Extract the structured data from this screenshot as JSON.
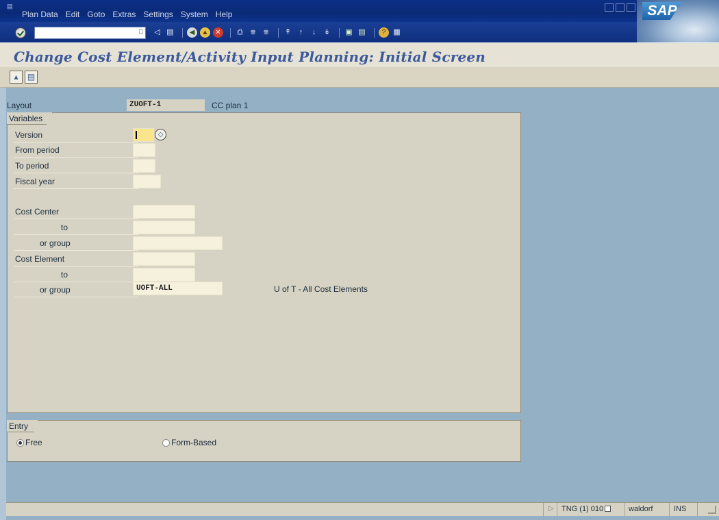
{
  "menu": {
    "items": [
      "Plan Data",
      "Edit",
      "Goto",
      "Extras",
      "Settings",
      "System",
      "Help"
    ]
  },
  "brand": {
    "logo_text": "SAP"
  },
  "toolbar": {
    "command_field_value": "",
    "icons": [
      "enter-icon",
      "save-icon",
      "back-icon",
      "exit-icon",
      "cancel-icon",
      "print-icon",
      "find-icon",
      "find-next-icon",
      "first-page-icon",
      "previous-page-icon",
      "next-page-icon",
      "last-page-icon",
      "create-session-icon",
      "shortcut-icon",
      "help-icon",
      "customize-layout-icon"
    ]
  },
  "title": "Change Cost Element/Activity Input Planning: Initial Screen",
  "layout": {
    "label": "Layout",
    "value": "ZUOFT-1",
    "description": "CC plan 1"
  },
  "variables": {
    "group_title": "Variables",
    "rows": {
      "version": {
        "label": "Version",
        "value": ""
      },
      "from_period": {
        "label": "From period",
        "value": ""
      },
      "to_period": {
        "label": "To period",
        "value": ""
      },
      "fiscal_year": {
        "label": "Fiscal year",
        "value": ""
      },
      "cost_center": {
        "label": "Cost Center",
        "value": ""
      },
      "cost_center_to": {
        "label": "to",
        "value": ""
      },
      "cost_center_group": {
        "label": "or group",
        "value": ""
      },
      "cost_element": {
        "label": "Cost Element",
        "value": ""
      },
      "cost_element_to": {
        "label": "to",
        "value": ""
      },
      "cost_element_group": {
        "label": "or group",
        "value": "UOFT-ALL",
        "description": "U of T - All Cost Elements"
      }
    }
  },
  "entry": {
    "group_title": "Entry",
    "options": [
      {
        "label": "Free",
        "selected": true
      },
      {
        "label": "Form-Based",
        "selected": false
      }
    ]
  },
  "status": {
    "message": "",
    "system": "TNG (1) 010",
    "server": "waldorf",
    "mode": "INS"
  },
  "colors": {
    "background": "#93b0c5",
    "title_text": "#3b5a9c",
    "required_field": "#fbe58c",
    "menubar": "#0c2f86"
  }
}
